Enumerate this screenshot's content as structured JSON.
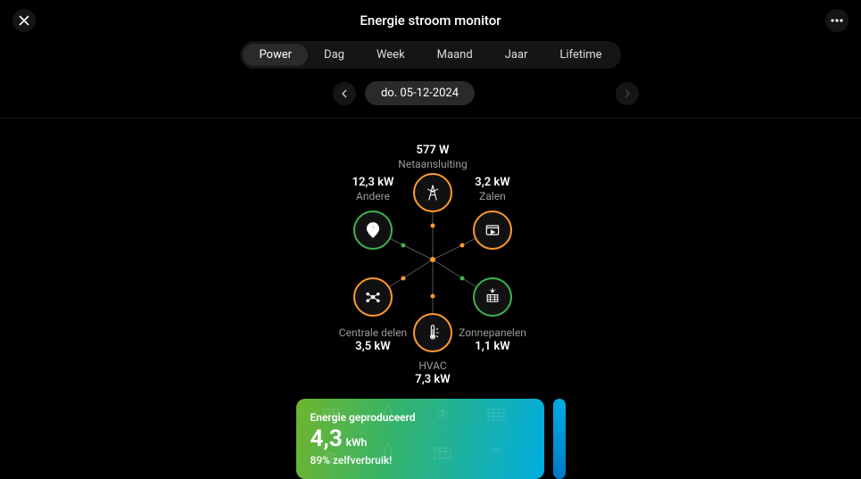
{
  "header": {
    "title": "Energie stroom monitor"
  },
  "tabs": {
    "items": [
      "Power",
      "Dag",
      "Week",
      "Maand",
      "Jaar",
      "Lifetime"
    ],
    "active": 0
  },
  "date": {
    "label": "do. 05-12-2024"
  },
  "nodes": {
    "grid": {
      "value": "577  W",
      "label": "Netaansluiting"
    },
    "other": {
      "value": "12,3  kW",
      "label": "Andere"
    },
    "rooms": {
      "value": "3,2  kW",
      "label": "Zalen"
    },
    "central": {
      "value": "3,5  kW",
      "label": "Centrale delen"
    },
    "solar": {
      "value": "1,1  kW",
      "label": "Zonnepanelen"
    },
    "hvac": {
      "value": "7,3  kW",
      "label": "HVAC"
    }
  },
  "card": {
    "title": "Energie geproduceerd",
    "value": "4,3",
    "unit": "kWh",
    "sub": "89% zelfverbruik!"
  },
  "chart_data": {
    "type": "table",
    "title": "Energie stroom monitor — Power — do. 05-12-2024",
    "series": [
      {
        "name": "Netaansluiting",
        "value": 577,
        "unit": "W"
      },
      {
        "name": "Andere",
        "value": 12.3,
        "unit": "kW"
      },
      {
        "name": "Zalen",
        "value": 3.2,
        "unit": "kW"
      },
      {
        "name": "Centrale delen",
        "value": 3.5,
        "unit": "kW"
      },
      {
        "name": "Zonnepanelen",
        "value": 1.1,
        "unit": "kW"
      },
      {
        "name": "HVAC",
        "value": 7.3,
        "unit": "kW"
      }
    ],
    "produced_kwh": 4.3,
    "self_consumption_pct": 89
  }
}
